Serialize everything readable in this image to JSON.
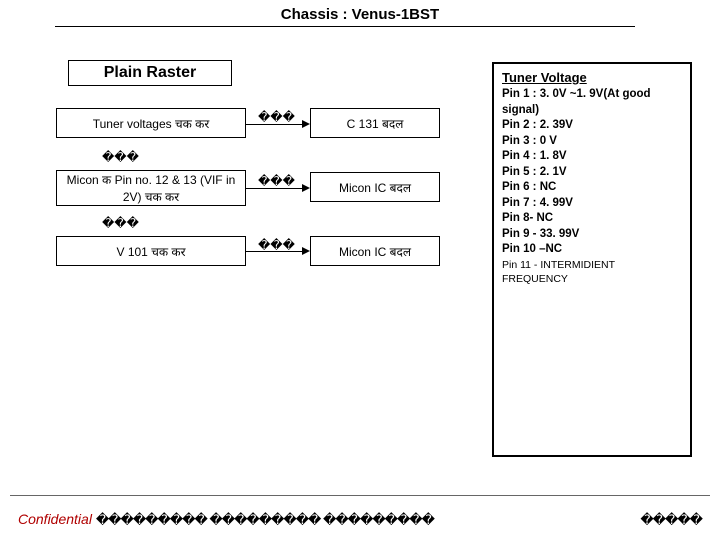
{
  "title": "Chassis : Venus-1BST",
  "section_header": "Plain  Raster",
  "flow": {
    "left": [
      "Tuner voltages चक   कर",
      "Micon क   Pin no. 12 & 13 (VIF in 2V) चक   कर",
      "V 101 चक   कर"
    ],
    "right": [
      "C 131 बदल",
      "Micon IC बदल",
      "Micon IC  बदल"
    ],
    "arrow_label": "���",
    "down_label": "���"
  },
  "voltage": {
    "title": "Tuner Voltage",
    "lines": [
      "Pin 1 :  3. 0V ~1. 9V(At good signal)",
      "Pin 2 :  2. 39V",
      "Pin 3 :  0 V",
      "Pin 4 :  1. 8V",
      "Pin 5 :  2. 1V",
      "Pin 6 :  NC",
      "Pin 7 :  4. 99V",
      "Pin 8- NC",
      "Pin 9 - 33. 99V",
      "Pin 10 –NC"
    ],
    "last": "Pin 11 - INTERMIDIENT FREQUENCY"
  },
  "footer": {
    "confidential": "Confidential ",
    "conf_boxes": "��������� ��������� ���������",
    "page_boxes": "�����"
  }
}
